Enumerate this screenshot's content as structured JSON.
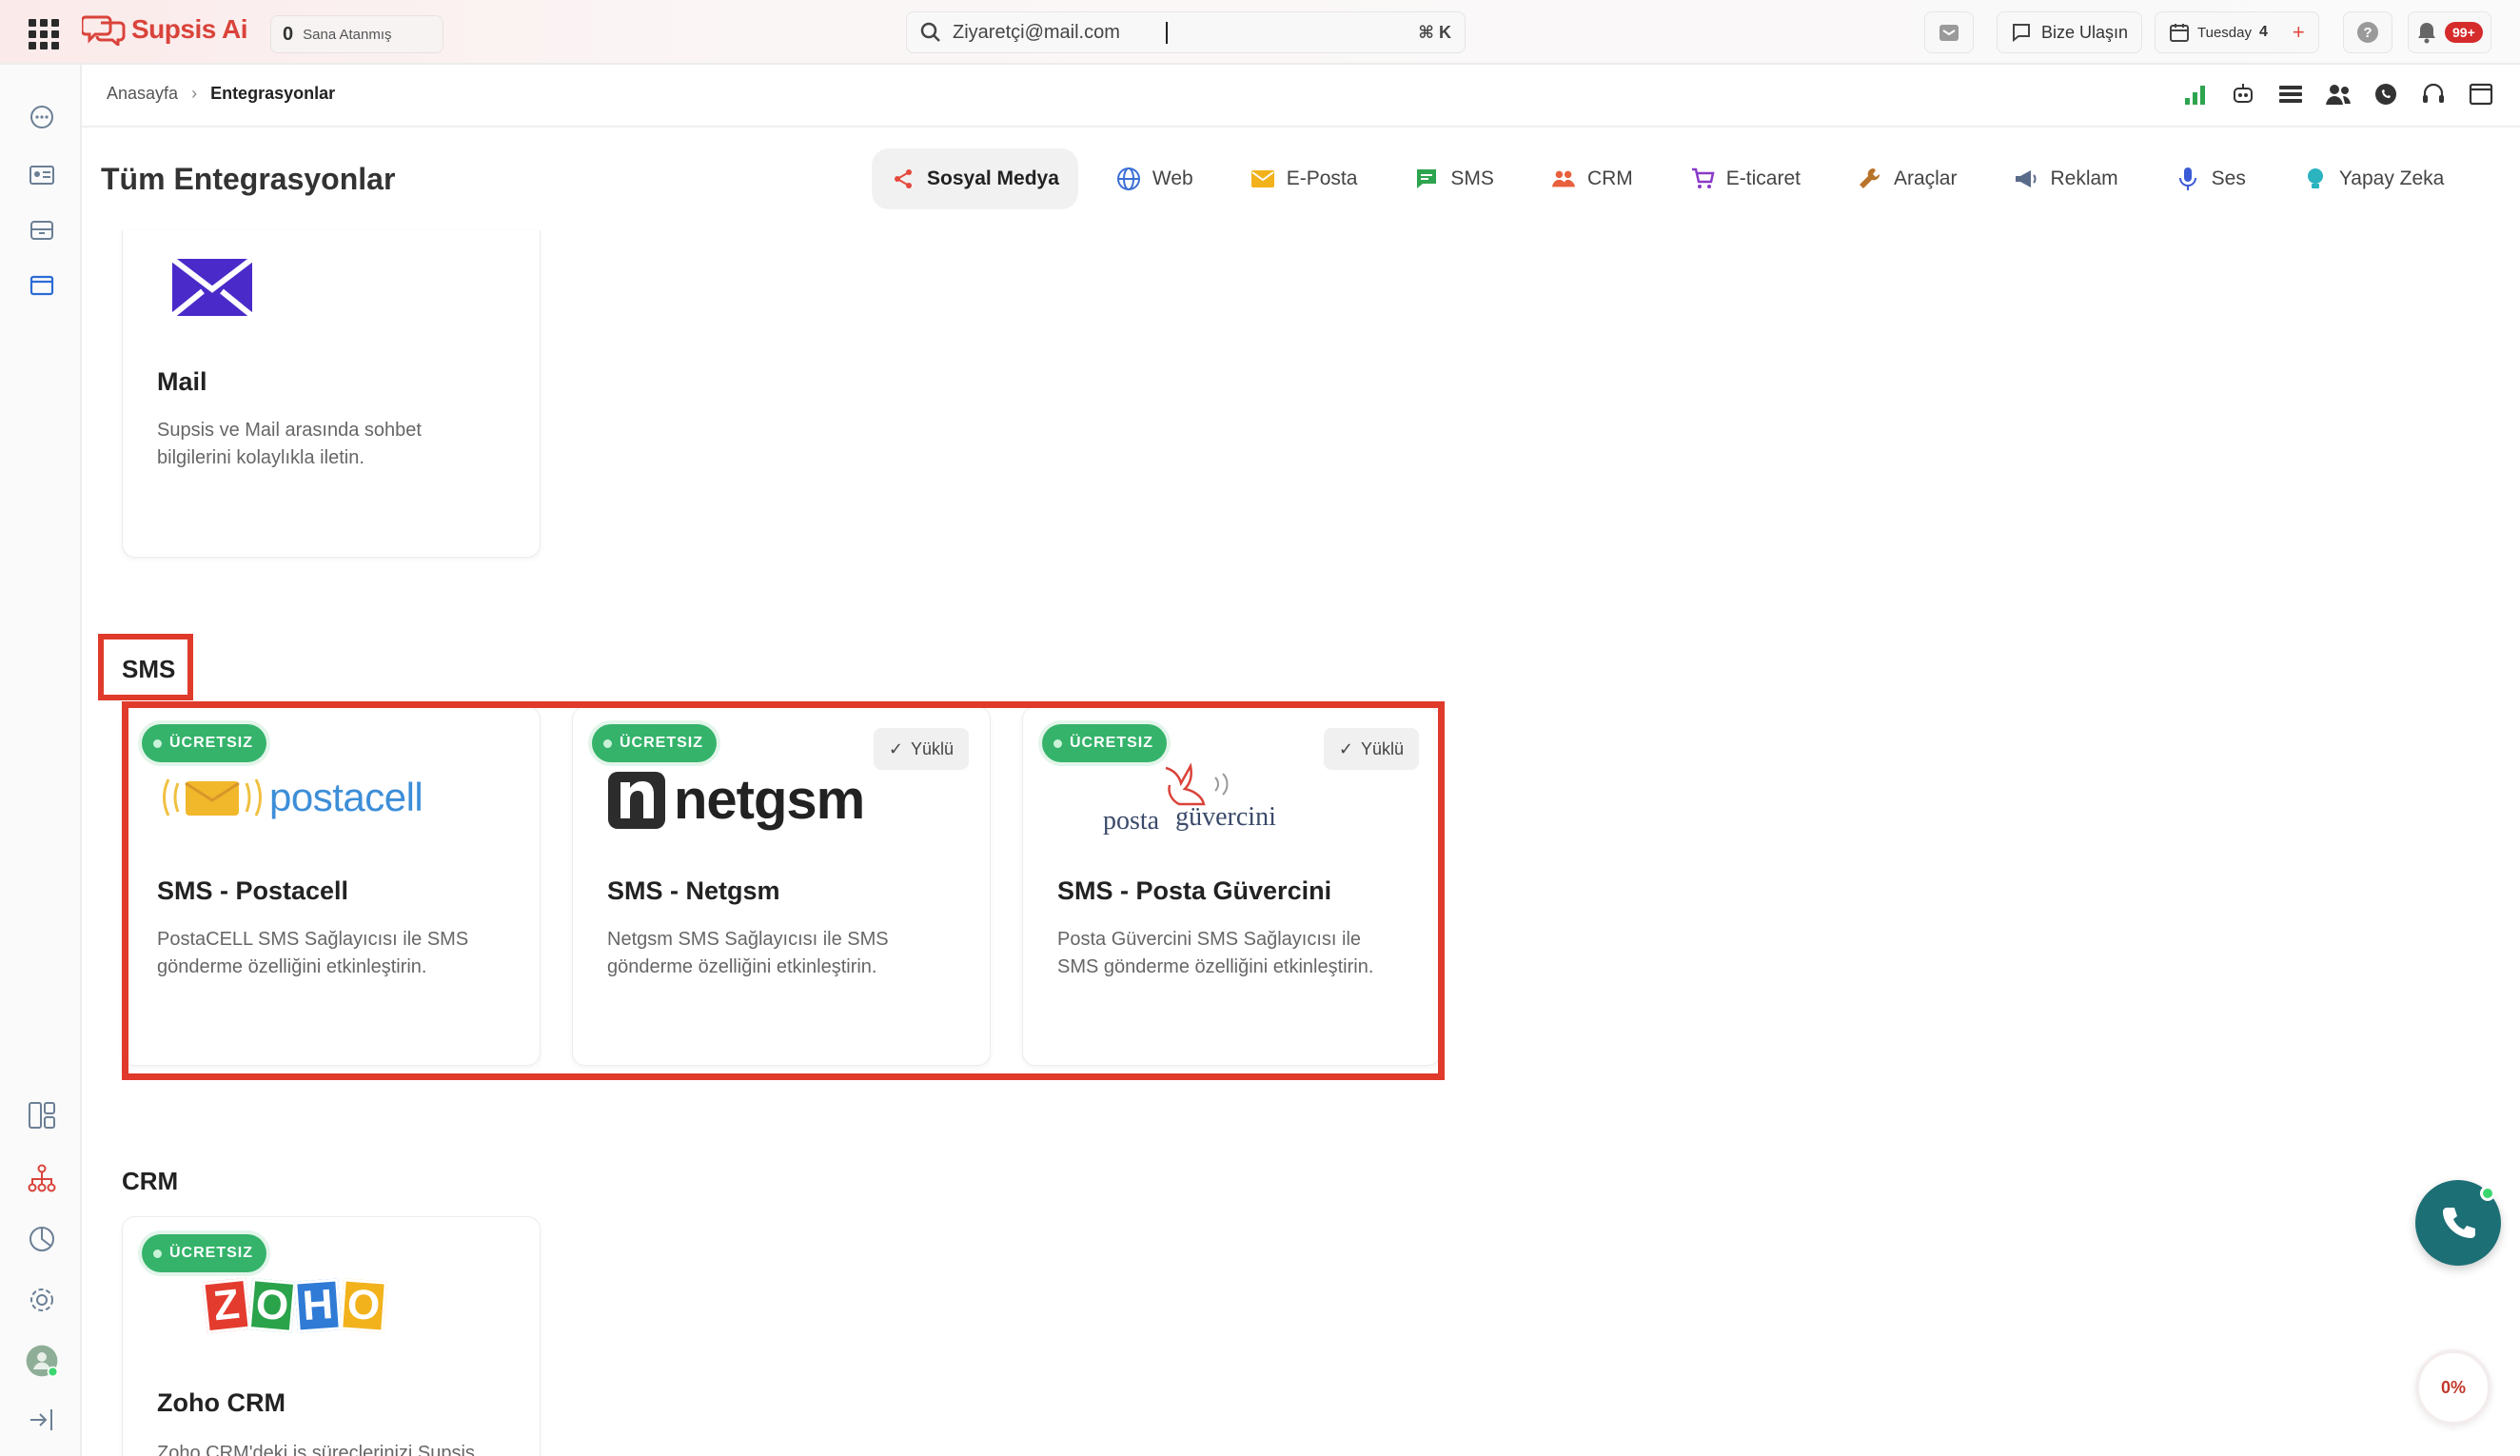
{
  "topbar": {
    "app_name": "Supsis Ai",
    "assigned_count": "0",
    "assigned_label": "Sana Atanmış",
    "search_value": "Ziyaretçi@mail.com",
    "search_shortcut": "⌘ K",
    "contact_label": "Bize Ulaşın",
    "date_day": "Tuesday",
    "date_num": "4",
    "notif_count": "99+"
  },
  "breadcrumb": {
    "home": "Anasayfa",
    "current": "Entegrasyonlar"
  },
  "page_title": "Tüm Entegrasyonlar",
  "tabs": [
    {
      "label": "Sosyal Medya",
      "icon": "share-icon",
      "color": "#e5483c"
    },
    {
      "label": "Web",
      "icon": "globe-icon",
      "color": "#3b6fd6"
    },
    {
      "label": "E-Posta",
      "icon": "envelope-icon",
      "color": "#f2b21b"
    },
    {
      "label": "SMS",
      "icon": "chat-icon",
      "color": "#2ea44f"
    },
    {
      "label": "CRM",
      "icon": "users-icon",
      "color": "#e8603c"
    },
    {
      "label": "E-ticaret",
      "icon": "cart-icon",
      "color": "#8a3ac8"
    },
    {
      "label": "Araçlar",
      "icon": "wrench-icon",
      "color": "#b8742a"
    },
    {
      "label": "Reklam",
      "icon": "megaphone-icon",
      "color": "#5a6b8a"
    },
    {
      "label": "Ses",
      "icon": "mic-icon",
      "color": "#3b5bd6"
    },
    {
      "label": "Yapay Zeka",
      "icon": "bulb-icon",
      "color": "#2bb3c0"
    }
  ],
  "mail_card": {
    "name": "Mail",
    "desc": "Supsis ve Mail arasında sohbet bilgilerini kolaylıkla iletin."
  },
  "sms_section": {
    "title": "SMS",
    "cards": [
      {
        "name": "SMS - Postacell",
        "desc": "PostaCELL SMS Sağlayıcısı ile SMS gönderme özelliğini etkinleştirin.",
        "badge": "ÜCRETSIZ",
        "logo_text": "postacell",
        "installed": ""
      },
      {
        "name": "SMS - Netgsm",
        "desc": "Netgsm SMS Sağlayıcısı ile SMS gönderme özelliğini etkinleştirin.",
        "badge": "ÜCRETSIZ",
        "logo_text": "netgsm",
        "installed": "Yüklü"
      },
      {
        "name": "SMS - Posta Güvercini",
        "desc": "Posta Güvercini SMS Sağlayıcısı ile SMS gönderme özelliğini etkinleştirin.",
        "badge": "ÜCRETSIZ",
        "logo_text_1": "posta",
        "logo_text_2": "güvercini",
        "installed": "Yüklü"
      }
    ]
  },
  "crm_section": {
    "title": "CRM",
    "card": {
      "name": "Zoho CRM",
      "desc": "Zoho CRM'deki iş süreçlerinizi Supsis",
      "badge": "ÜCRETSIZ",
      "logo_letters": [
        "Z",
        "O",
        "H",
        "O"
      ]
    }
  },
  "progress_label": "0%",
  "colors": {
    "brand": "#d9433a",
    "free_badge": "#35b36b",
    "highlight": "#e03a2a",
    "phone": "#1c6f74"
  }
}
